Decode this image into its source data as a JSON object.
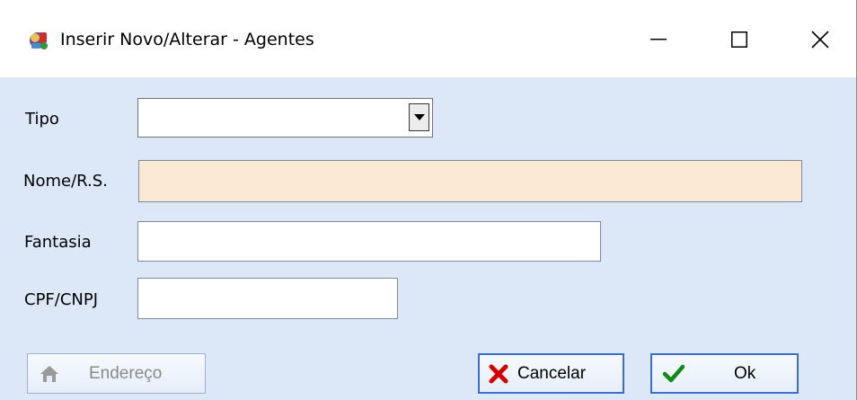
{
  "window": {
    "title": "Inserir Novo/Alterar - Agentes",
    "controls": [
      "minimize-icon",
      "maximize-icon",
      "close-icon"
    ]
  },
  "form": {
    "tipo": {
      "label": "Tipo",
      "value": ""
    },
    "nome": {
      "label": "Nome/R.S.",
      "value": "",
      "required_color": "#fce9d4"
    },
    "fantasia": {
      "label": "Fantasia",
      "value": ""
    },
    "cpf_cnpj": {
      "label": "CPF/CNPJ",
      "value": ""
    }
  },
  "buttons": {
    "endereco": {
      "label": "Endereço",
      "icon": "house-icon",
      "enabled": false
    },
    "cancelar": {
      "label": "Cancelar",
      "icon": "x-icon",
      "color": "#d40000"
    },
    "ok": {
      "label": "Ok",
      "icon": "check-icon",
      "color": "#138a18"
    }
  },
  "colors": {
    "background": "#dce7f8",
    "focus_border": "#3a6fd0"
  }
}
